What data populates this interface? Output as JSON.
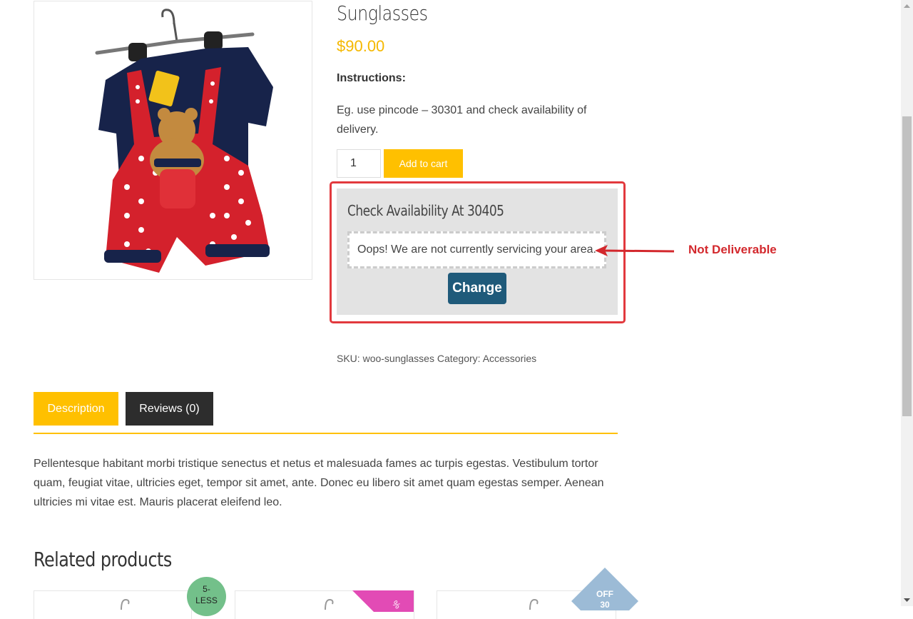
{
  "product": {
    "title": "Sunglasses",
    "price": "$90.00",
    "instructions_heading": "Instructions:",
    "instructions_body": "Eg. use pincode – 30301 and check availability of delivery.",
    "quantity": "1",
    "add_to_cart_label": "Add to cart"
  },
  "availability": {
    "title": "Check Availability At 30405",
    "message": "Oops! We are not currently servicing your area.",
    "change_label": "Change"
  },
  "annotation": {
    "label": "Not Deliverable",
    "color": "#d3282d"
  },
  "meta": {
    "sku_label": "SKU:",
    "sku_value": "woo-sunglasses",
    "category_label": "Category:",
    "category_value": "Accessories"
  },
  "tabs": [
    {
      "label": "Description",
      "active": true
    },
    {
      "label": "Reviews (0)",
      "active": false
    }
  ],
  "description": "Pellentesque habitant morbi tristique senectus et netus et malesuada fames ac turpis egestas. Vestibulum tortor quam, feugiat vitae, ultricies eget, tempor sit amet, ante. Donec eu libero sit amet quam egestas semper. Aenean ultricies mi vitae est. Mauris placerat eleifend leo.",
  "related": {
    "heading": "Related products",
    "badges": {
      "circle_line1": "5-",
      "circle_line2": "LESS",
      "diamond_line1": "OFF",
      "diamond_line2": "30"
    }
  },
  "colors": {
    "accent_yellow": "#ffc000",
    "price_yellow": "#f5b800",
    "change_button": "#1f5a7a",
    "highlight_red": "#e2393d",
    "dark_tab": "#2d2d2d"
  }
}
